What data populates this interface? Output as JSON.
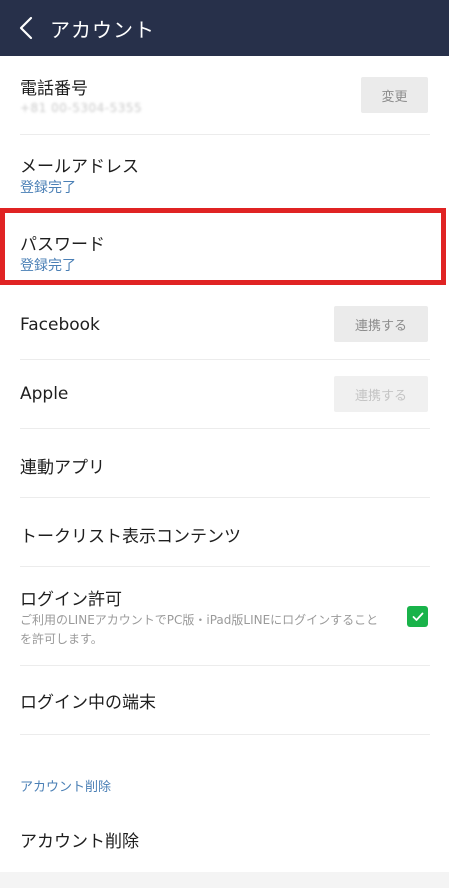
{
  "header": {
    "title": "アカウント"
  },
  "phone": {
    "label": "電話番号",
    "masked_value": "+81 00-5304-5355",
    "button": "変更"
  },
  "email": {
    "label": "メールアドレス",
    "status": "登録完了"
  },
  "password": {
    "label": "パスワード",
    "status": "登録完了"
  },
  "facebook": {
    "label": "Facebook",
    "button": "連携する"
  },
  "apple": {
    "label": "Apple",
    "button": "連携する"
  },
  "linked_apps": {
    "label": "連動アプリ"
  },
  "talk_list": {
    "label": "トークリスト表示コンテンツ"
  },
  "login_permission": {
    "label": "ログイン許可",
    "description": "ご利用のLINEアカウントでPC版・iPad版LINEにログインすることを許可します。",
    "checked": true
  },
  "logged_in_devices": {
    "label": "ログイン中の端末"
  },
  "delete_section": {
    "header": "アカウント削除",
    "item": "アカウント削除"
  },
  "colors": {
    "header_bg": "#27304a",
    "link_blue": "#4a7fb5",
    "highlight_red": "#e02323",
    "check_green": "#19b34a"
  }
}
